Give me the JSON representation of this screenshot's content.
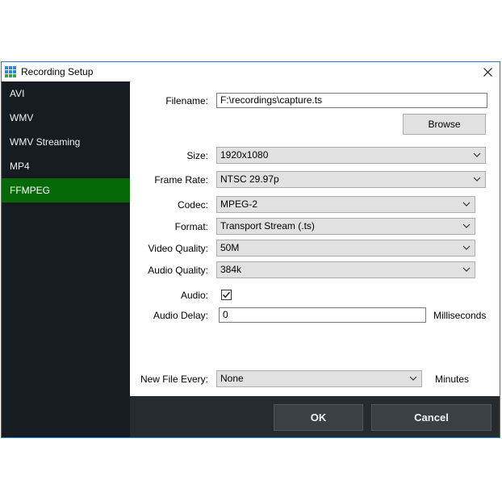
{
  "window": {
    "title": "Recording Setup",
    "icon": "grid-app-icon",
    "close_icon": "close-icon"
  },
  "sidebar": {
    "items": [
      {
        "label": "AVI",
        "active": false
      },
      {
        "label": "WMV",
        "active": false
      },
      {
        "label": "WMV Streaming",
        "active": false
      },
      {
        "label": "MP4",
        "active": false
      },
      {
        "label": "FFMPEG",
        "active": true
      }
    ]
  },
  "form": {
    "filename": {
      "label": "Filename:",
      "value": "F:\\recordings\\capture.ts"
    },
    "browse_label": "Browse",
    "size": {
      "label": "Size:",
      "value": "1920x1080"
    },
    "frame_rate": {
      "label": "Frame Rate:",
      "value": "NTSC 29.97p"
    },
    "codec": {
      "label": "Codec:",
      "value": "MPEG-2"
    },
    "format": {
      "label": "Format:",
      "value": "Transport Stream (.ts)"
    },
    "video_quality": {
      "label": "Video Quality:",
      "value": "50M"
    },
    "audio_quality": {
      "label": "Audio Quality:",
      "value": "384k"
    },
    "audio": {
      "label": "Audio:",
      "checked": true
    },
    "audio_delay": {
      "label": "Audio Delay:",
      "value": "0",
      "unit": "Milliseconds"
    },
    "new_file_every": {
      "label": "New File Every:",
      "value": "None",
      "unit": "Minutes"
    }
  },
  "footer": {
    "ok_label": "OK",
    "cancel_label": "Cancel"
  },
  "colors": {
    "sidebar_bg": "#161c22",
    "sidebar_active": "#066907",
    "footer_bg": "#262b30",
    "window_border": "#1e7fd6"
  }
}
